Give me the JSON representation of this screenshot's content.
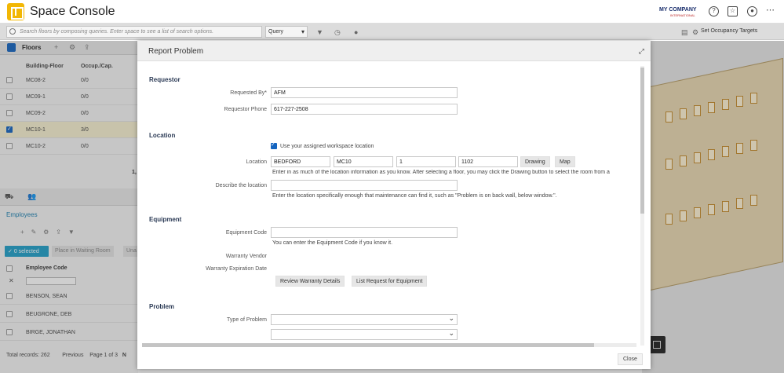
{
  "app": {
    "title": "Space Console",
    "brand": "MY COMPANY",
    "brand_sub": "INTERNATIONAL"
  },
  "header_icons": [
    "help-icon",
    "star-settings-icon",
    "user-icon",
    "more-icon"
  ],
  "toolbar": {
    "search_placeholder": "Search floors by composing queries. Enter space to see a list of search options.",
    "query_value": "Query",
    "occupancy_label": "Set Occupancy Targets"
  },
  "floors": {
    "title": "Floors",
    "columns": [
      "Building-Floor",
      "Occup./Cap."
    ],
    "rows": [
      {
        "floor": "MC08-2",
        "occ": "0/0",
        "checked": false
      },
      {
        "floor": "MC09-1",
        "occ": "0/0",
        "checked": false
      },
      {
        "floor": "MC09-2",
        "occ": "0/0",
        "checked": false
      },
      {
        "floor": "MC10-1",
        "occ": "3/0",
        "checked": true
      },
      {
        "floor": "MC10-2",
        "occ": "0/0",
        "checked": false
      }
    ],
    "page_fragment": "1,"
  },
  "employees": {
    "title": "Employees",
    "selected_label": "0 selected",
    "waiting_room_label": "Place in Waiting Room",
    "more_label": "Una",
    "column": "Employee Code",
    "rows": [
      "BENSON, SEAN",
      "BEUGRONE, DEB",
      "BIRGE, JONATHAN"
    ],
    "footer": {
      "total": "Total records: 262",
      "previous": "Previous",
      "page": "Page 1 of 3",
      "next": "N"
    }
  },
  "modal": {
    "title": "Report Problem",
    "requestor": {
      "section": "Requestor",
      "requested_by_label": "Requested By*",
      "requested_by_value": "AFM",
      "phone_label": "Requestor Phone",
      "phone_value": "617-227-2508"
    },
    "location": {
      "section": "Location",
      "checkbox_label": "Use your assigned workspace location",
      "location_label": "Location",
      "building": "BEDFORD",
      "floor": "MC10",
      "level": "1",
      "room": "1102",
      "drawing_button": "Drawing",
      "map_button": "Map",
      "location_hint": "Enter in as much of the location information as you know. After selecting a floor, you may click the Drawing button to select the room from a",
      "describe_label": "Describe the location",
      "describe_hint": "Enter the location specifically enough that maintenance can find it, such as \"Problem is on back wall, below window.\"."
    },
    "equipment": {
      "section": "Equipment",
      "code_label": "Equipment Code",
      "code_hint": "You can enter the Equipment Code if you know it.",
      "vendor_label": "Warranty Vendor",
      "expiration_label": "Warranty Expiration Date",
      "review_button": "Review Warranty Details",
      "list_button": "List Request for Equipment"
    },
    "problem": {
      "section": "Problem",
      "type_label": "Type of Problem"
    },
    "close_button": "Close"
  }
}
